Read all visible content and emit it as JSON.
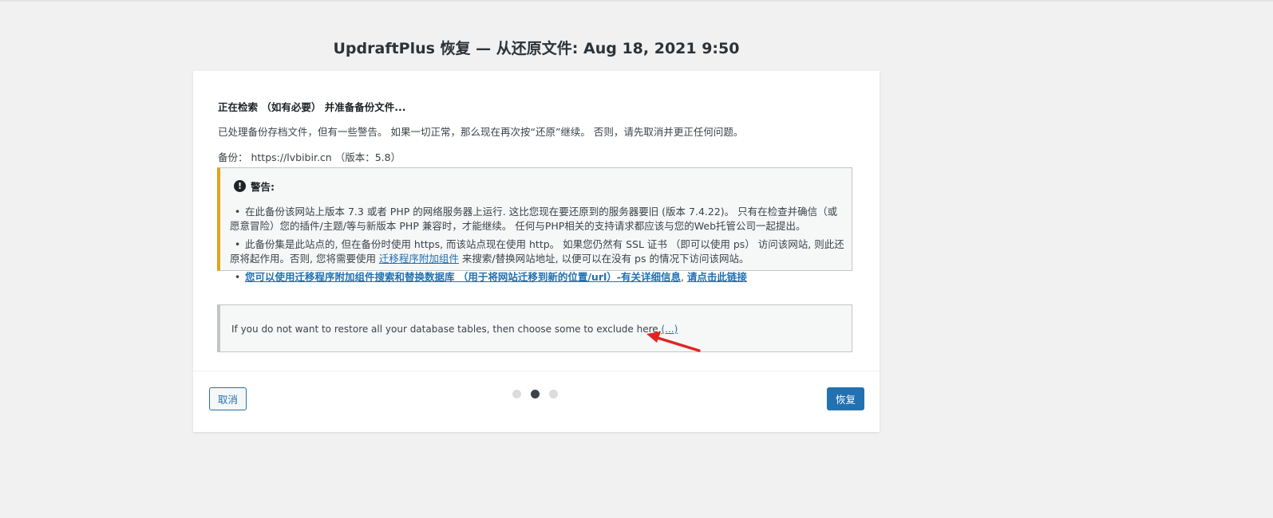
{
  "page": {
    "title": "UpdraftPlus 恢复 — 从还原文件: Aug 18, 2021 9:50"
  },
  "step": {
    "heading": "正在检索 （如有必要） 并准备备份文件...",
    "processed_text": "已处理备份存档文件，但有一些警告。 如果一切正常，那么现在再次按“还原”继续。 否则，请先取消并更正任何问题。",
    "backup_info": "备份： https://lvbibir.cn （版本：5.8）"
  },
  "warning": {
    "icon": "exclamation-circle-icon",
    "title": "警告:",
    "items": [
      {
        "text": "在此备份该网站上版本 7.3 或者 PHP 的网络服务器上运行. 这比您现在要还原到的服务器要旧 (版本 7.4.22)。 只有在检查并确信（或愿意冒险）您的插件/主题/等与新版本 PHP 兼容时，才能继续。 任何与PHP相关的支持请求都应该与您的Web托管公司一起提出。"
      },
      {
        "text_before": "此备份集是此站点的, 但在备份时使用 https, 而该站点现在使用 http。 如果您仍然有 SSL 证书 （即可以使用 ps） 访问该网站, 则此还原将起作用。否则, 您将需要使用 ",
        "link": "迁移程序附加组件",
        "text_after": " 来搜索/替换网站地址, 以便可以在没有 ps 的情况下访问该网站。"
      },
      {
        "link": "您可以使用迁移程序附加组件搜索和替换数据库 （用于将网站迁移到新的位置/url）-有关详细信息",
        "separator": ", ",
        "link2": "请点击此链接"
      }
    ]
  },
  "exclude": {
    "text": "If you do not want to restore all your database tables, then choose some to exclude here.",
    "link": "(...)"
  },
  "footer": {
    "cancel_label": "取消",
    "restore_label": "恢复",
    "steps_total": 3,
    "active_step": 2
  },
  "colors": {
    "background": "#f1f1f1",
    "card": "#ffffff",
    "primary": "#2271b1",
    "warning_border": "#dba617",
    "arrow": "#e02424"
  }
}
